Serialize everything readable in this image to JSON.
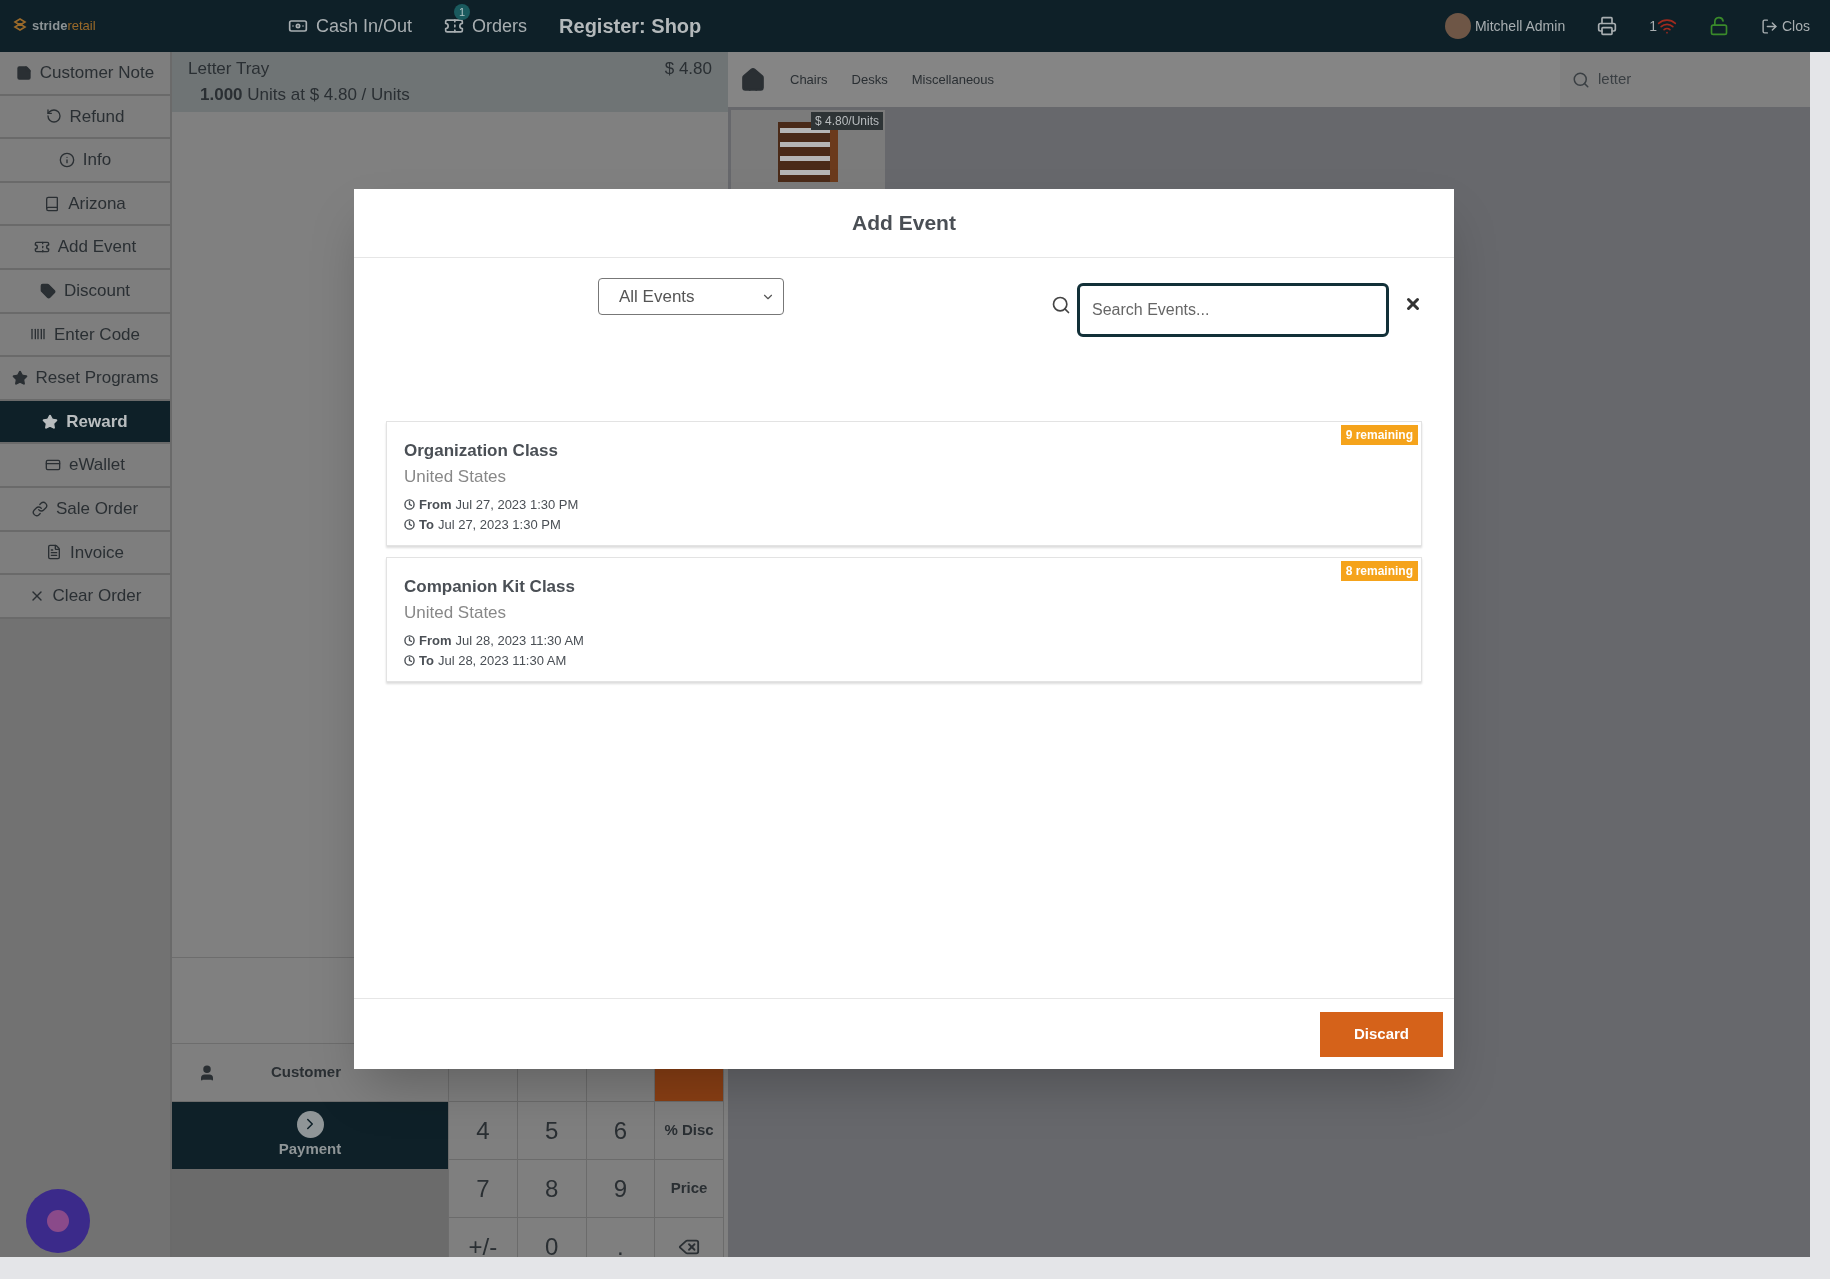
{
  "topbar": {
    "logo": {
      "strong": "stride",
      "light": "retail"
    },
    "nav": [
      {
        "kind": "cash",
        "label": "Cash In/Out"
      },
      {
        "kind": "orders",
        "label": "Orders",
        "badge": "1"
      }
    ],
    "register": "Register: Shop",
    "user": "Mitchell Admin",
    "pending": "1",
    "close": "Clos"
  },
  "sidebar": {
    "items": [
      {
        "label": "Customer Note",
        "selected": false
      },
      {
        "label": "Refund",
        "selected": false
      },
      {
        "label": "Info",
        "selected": false
      },
      {
        "label": "Arizona",
        "selected": false
      },
      {
        "label": "Add Event",
        "selected": false
      },
      {
        "label": "Discount",
        "selected": false
      },
      {
        "label": "Enter Code",
        "selected": false
      },
      {
        "label": "Reset Programs",
        "selected": false
      },
      {
        "label": "Reward",
        "selected": true
      },
      {
        "label": "eWallet",
        "selected": false
      },
      {
        "label": "Sale Order",
        "selected": false
      },
      {
        "label": "Invoice",
        "selected": false
      },
      {
        "label": "Clear Order",
        "selected": false
      }
    ]
  },
  "order": {
    "line": {
      "name": "Letter Tray",
      "price": "$ 4.80",
      "detail": "**1.000** Units at $ 4.80 / Units"
    },
    "customer": "Customer",
    "payment": "Payment",
    "numpad": [
      {
        "kind": "blank"
      },
      {
        "kind": "blank"
      },
      {
        "kind": "blank"
      },
      {
        "kind": "mode",
        "selected": true
      },
      {
        "kind": "digit",
        "label": "4"
      },
      {
        "kind": "digit",
        "label": "5"
      },
      {
        "kind": "digit",
        "label": "6"
      },
      {
        "kind": "mode",
        "label": "% Disc",
        "selected": false
      },
      {
        "kind": "digit",
        "label": "7"
      },
      {
        "kind": "digit",
        "label": "8"
      },
      {
        "kind": "digit",
        "label": "9"
      },
      {
        "kind": "mode",
        "label": "Price",
        "selected": false
      },
      {
        "kind": "digit",
        "label": "+/-"
      },
      {
        "kind": "digit",
        "label": "0"
      },
      {
        "kind": "digit",
        "label": "."
      },
      {
        "kind": "backspace"
      }
    ]
  },
  "products": {
    "categories": [
      "Chairs",
      "Desks",
      "Miscellaneous"
    ],
    "search": "letter",
    "items": [
      {
        "price": "$ 4.80/Units"
      }
    ]
  },
  "modal": {
    "title": "Add Event",
    "filter": "All Events",
    "search_placeholder": "Search Events...",
    "events": [
      {
        "name": "Organization Class",
        "location": "United States",
        "from_label": "From",
        "from": "Jul 27, 2023 1:30 PM",
        "to_label": "To",
        "to": "Jul 27, 2023 1:30 PM",
        "remaining": "9 remaining"
      },
      {
        "name": "Companion Kit Class",
        "location": "United States",
        "from_label": "From",
        "from": "Jul 28, 2023 11:30 AM",
        "to_label": "To",
        "to": "Jul 28, 2023 11:30 AM",
        "remaining": "8 remaining"
      }
    ],
    "discard": "Discard"
  }
}
